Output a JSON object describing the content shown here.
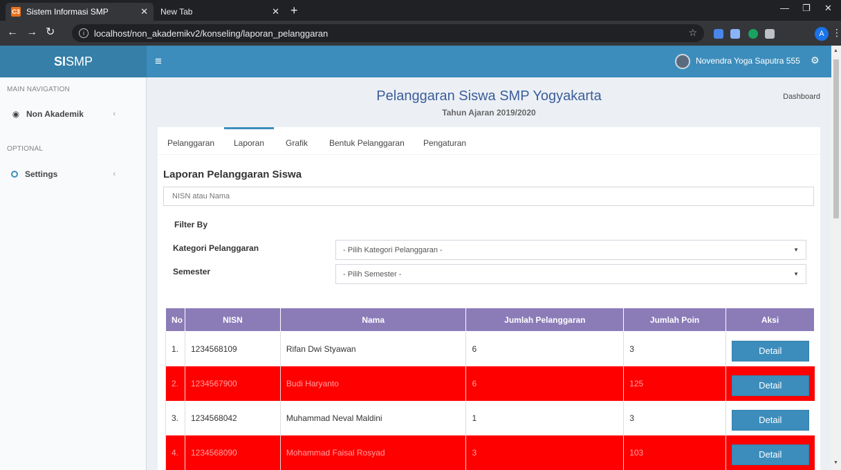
{
  "browser": {
    "tabs": [
      {
        "title": "Sistem Informasi SMP",
        "favicon": "C3"
      },
      {
        "title": "New Tab"
      }
    ],
    "url": "localhost/non_akademikv2/konseling/laporan_pelanggaran",
    "profile_initial": "A"
  },
  "header": {
    "logo_bold": "SI",
    "logo_rest": "SMP",
    "user_name": "Novendra Yoga Saputra 555"
  },
  "sidebar": {
    "main_nav_header": "MAIN NAVIGATION",
    "items": [
      {
        "label": "Non Akademik",
        "icon": "dashboard-icon"
      }
    ],
    "optional_header": "OPTIONAL",
    "optional_items": [
      {
        "label": "Settings",
        "icon": "circle-icon"
      }
    ]
  },
  "page": {
    "title": "Pelanggaran Siswa SMP Yogyakarta",
    "subtitle": "Tahun Ajaran 2019/2020",
    "breadcrumb": "Dashboard"
  },
  "tabs": [
    {
      "label": "Pelanggaran",
      "active": false
    },
    {
      "label": "Laporan",
      "active": true
    },
    {
      "label": "Grafik",
      "active": false
    },
    {
      "label": "Bentuk Pelanggaran",
      "active": false
    },
    {
      "label": "Pengaturan",
      "active": false
    }
  ],
  "report": {
    "section_title": "Laporan Pelanggaran Siswa",
    "search_placeholder": "NISN atau Nama",
    "filter_title": "Filter By",
    "filters": [
      {
        "label": "Kategori Pelanggaran",
        "value": "- Pilih Kategori Pelanggaran -"
      },
      {
        "label": "Semester",
        "value": "- Pilih Semester -"
      }
    ]
  },
  "table": {
    "columns": [
      "No",
      "NISN",
      "Nama",
      "Jumlah Pelanggaran",
      "Jumlah Poin",
      "Aksi"
    ],
    "rows": [
      {
        "no": "1.",
        "nisn": "1234568109",
        "nama": "Rifan Dwi Styawan",
        "jumlah_pelanggaran": "6",
        "jumlah_poin": "3",
        "aksi": "Detail",
        "highlight": false
      },
      {
        "no": "2.",
        "nisn": "1234567900",
        "nama": "Budi Haryanto",
        "jumlah_pelanggaran": "6",
        "jumlah_poin": "125",
        "aksi": "Detail",
        "highlight": true
      },
      {
        "no": "3.",
        "nisn": "1234568042",
        "nama": "Muhammad Neval Maldini",
        "jumlah_pelanggaran": "1",
        "jumlah_poin": "3",
        "aksi": "Detail",
        "highlight": false
      },
      {
        "no": "4.",
        "nisn": "1234568090",
        "nama": "Mohammad Faisal Rosyad",
        "jumlah_pelanggaran": "3",
        "jumlah_poin": "103",
        "aksi": "Detail",
        "highlight": true
      }
    ]
  },
  "colors": {
    "header_blue": "#3c8dbc",
    "logo_blue": "#367fa9",
    "table_header": "#8b7cb8",
    "highlight_row": "#ff0000",
    "button_blue": "#3c8dbc"
  }
}
